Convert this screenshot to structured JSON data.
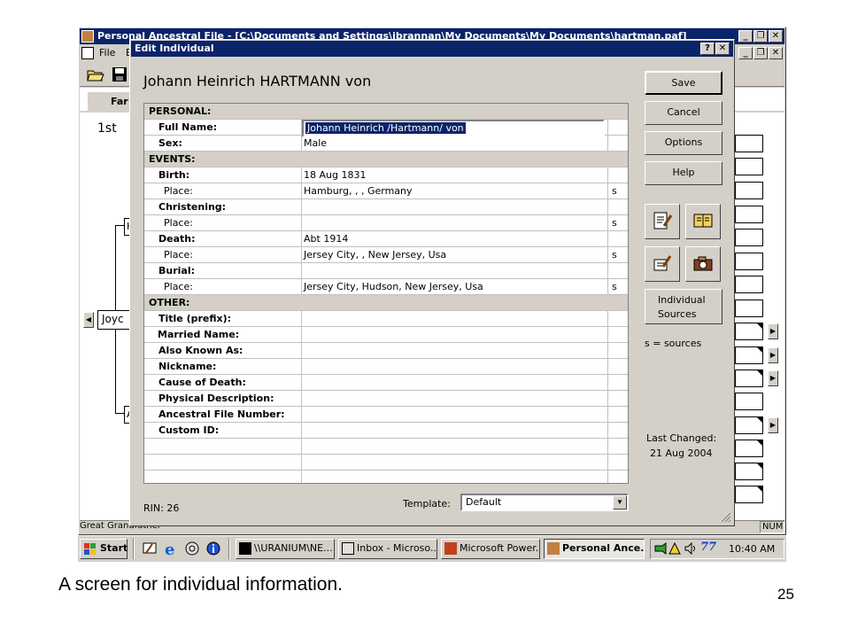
{
  "main_window": {
    "title": "Personal Ancestral File - [C:\\Documents and Settings\\jbrannan\\My Documents\\My Documents\\hartman.paf]",
    "menu_file": "File",
    "menu_e": "E",
    "tab_partial": "Far",
    "generation_label": "1st",
    "tree_box_1": "H",
    "tree_box_joyce": "Joyc",
    "tree_box_2": "A",
    "status_left": "Great Grandfather",
    "status_num": "NUM"
  },
  "dialog": {
    "title": "Edit Individual",
    "individual_name": "Johann Heinrich HARTMANN von",
    "sections": {
      "personal": "PERSONAL:",
      "events": "EVENTS:",
      "other": "OTHER:"
    },
    "fields": {
      "full_name_label": "Full Name:",
      "full_name_value": "Johann Heinrich /Hartmann/ von",
      "sex_label": "Sex:",
      "sex_value": "Male",
      "birth_label": "Birth:",
      "birth_value": "18 Aug 1831",
      "birth_place_label": "Place:",
      "birth_place_value": "Hamburg, , , Germany",
      "birth_place_src": "s",
      "christening_label": "Christening:",
      "christening_place_label": "Place:",
      "christening_place_src": "s",
      "death_label": "Death:",
      "death_value": "Abt 1914",
      "death_place_label": "Place:",
      "death_place_value": "Jersey City, , New Jersey, Usa",
      "death_place_src": "s",
      "burial_label": "Burial:",
      "burial_place_label": "Place:",
      "burial_place_value": "Jersey City, Hudson, New Jersey, Usa",
      "burial_place_src": "s",
      "title_prefix_label": "Title (prefix):",
      "married_name_label": "Married Name:",
      "aka_label": "Also Known As:",
      "nickname_label": "Nickname:",
      "cause_of_death_label": "Cause of Death:",
      "physical_description_label": "Physical Description:",
      "afn_label": "Ancestral File Number:",
      "custom_id_label": "Custom ID:"
    },
    "buttons": {
      "save": "Save",
      "cancel": "Cancel",
      "options": "Options",
      "help": "Help",
      "individual_sources_line1": "Individual",
      "individual_sources_line2": "Sources"
    },
    "sources_legend": "s = sources",
    "last_changed_label": "Last Changed:",
    "last_changed_date": "21 Aug 2004",
    "rin": "RIN: 26",
    "template_label": "Template:",
    "template_value": "Default",
    "help_glyph": "?",
    "close_glyph": "✕"
  },
  "taskbar": {
    "start": "Start",
    "tasks": [
      "\\\\URANIUM\\NE...",
      "Inbox - Microso...",
      "Microsoft Power...",
      "Personal Ance..."
    ],
    "clock": "10:40 AM"
  },
  "caption": "A screen for individual information.",
  "page_number": "25",
  "icons": [
    "app-icon",
    "open-folder-icon",
    "save-disk-icon",
    "edit-notes-icon",
    "book-icon",
    "edit-pencil-icon",
    "camera-icon",
    "windows-flag-icon",
    "internet-explorer-icon",
    "dropdown-arrow-icon"
  ],
  "colors": {
    "titlebar": "#0a246a",
    "window_face": "#d4d0c8",
    "selection": "#0a246a"
  }
}
